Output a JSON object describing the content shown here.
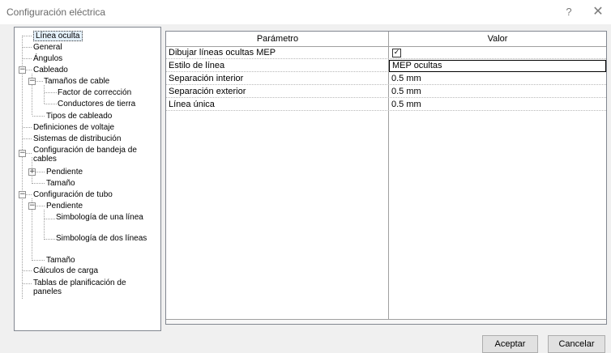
{
  "window": {
    "title": "Configuración eléctrica",
    "help_label": "?",
    "close_label": "✕"
  },
  "tree": {
    "items": [
      {
        "label": "Línea oculta",
        "selected": true
      },
      {
        "label": "General"
      },
      {
        "label": "Ángulos"
      },
      {
        "label": "Cableado",
        "expander": "−"
      },
      {
        "label": "Tamaños de cable",
        "expander": "−"
      },
      {
        "label": "Factor de corrección"
      },
      {
        "label": "Conductores de tierra"
      },
      {
        "label": "Tipos de cableado"
      },
      {
        "label": "Definiciones de voltaje"
      },
      {
        "label": "Sistemas de distribución"
      },
      {
        "label": "Configuración de bandeja de cables",
        "expander": "−"
      },
      {
        "label": "Pendiente",
        "expander": "+"
      },
      {
        "label": "Tamaño"
      },
      {
        "label": "Configuración de tubo",
        "expander": "−"
      },
      {
        "label": "Pendiente",
        "expander": "−"
      },
      {
        "label": "Simbología de una línea"
      },
      {
        "label": "Simbología de dos líneas"
      },
      {
        "label": "Tamaño"
      },
      {
        "label": "Cálculos de carga"
      },
      {
        "label": "Tablas de planificación de paneles"
      }
    ]
  },
  "grid": {
    "headers": [
      "Parámetro",
      "Valor"
    ],
    "rows": [
      {
        "param": "Dibujar líneas ocultas MEP",
        "value": "",
        "checkbox": true,
        "checked": "✓"
      },
      {
        "param": "Estilo de línea",
        "value": "MEP ocultas"
      },
      {
        "param": "Separación interior",
        "value": "0.5 mm"
      },
      {
        "param": "Separación exterior",
        "value": "0.5 mm"
      },
      {
        "param": "Línea única",
        "value": "0.5 mm"
      }
    ]
  },
  "buttons": {
    "ok": "Aceptar",
    "cancel": "Cancelar"
  }
}
